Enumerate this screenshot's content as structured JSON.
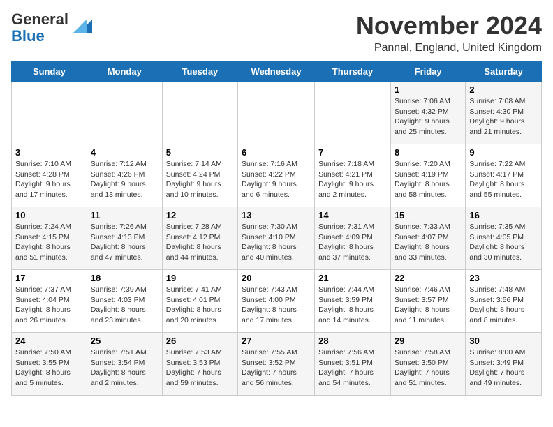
{
  "logo": {
    "line1": "General",
    "line2": "Blue"
  },
  "title": "November 2024",
  "subtitle": "Pannal, England, United Kingdom",
  "days_of_week": [
    "Sunday",
    "Monday",
    "Tuesday",
    "Wednesday",
    "Thursday",
    "Friday",
    "Saturday"
  ],
  "weeks": [
    [
      {
        "day": "",
        "info": ""
      },
      {
        "day": "",
        "info": ""
      },
      {
        "day": "",
        "info": ""
      },
      {
        "day": "",
        "info": ""
      },
      {
        "day": "",
        "info": ""
      },
      {
        "day": "1",
        "info": "Sunrise: 7:06 AM\nSunset: 4:32 PM\nDaylight: 9 hours and 25 minutes."
      },
      {
        "day": "2",
        "info": "Sunrise: 7:08 AM\nSunset: 4:30 PM\nDaylight: 9 hours and 21 minutes."
      }
    ],
    [
      {
        "day": "3",
        "info": "Sunrise: 7:10 AM\nSunset: 4:28 PM\nDaylight: 9 hours and 17 minutes."
      },
      {
        "day": "4",
        "info": "Sunrise: 7:12 AM\nSunset: 4:26 PM\nDaylight: 9 hours and 13 minutes."
      },
      {
        "day": "5",
        "info": "Sunrise: 7:14 AM\nSunset: 4:24 PM\nDaylight: 9 hours and 10 minutes."
      },
      {
        "day": "6",
        "info": "Sunrise: 7:16 AM\nSunset: 4:22 PM\nDaylight: 9 hours and 6 minutes."
      },
      {
        "day": "7",
        "info": "Sunrise: 7:18 AM\nSunset: 4:21 PM\nDaylight: 9 hours and 2 minutes."
      },
      {
        "day": "8",
        "info": "Sunrise: 7:20 AM\nSunset: 4:19 PM\nDaylight: 8 hours and 58 minutes."
      },
      {
        "day": "9",
        "info": "Sunrise: 7:22 AM\nSunset: 4:17 PM\nDaylight: 8 hours and 55 minutes."
      }
    ],
    [
      {
        "day": "10",
        "info": "Sunrise: 7:24 AM\nSunset: 4:15 PM\nDaylight: 8 hours and 51 minutes."
      },
      {
        "day": "11",
        "info": "Sunrise: 7:26 AM\nSunset: 4:13 PM\nDaylight: 8 hours and 47 minutes."
      },
      {
        "day": "12",
        "info": "Sunrise: 7:28 AM\nSunset: 4:12 PM\nDaylight: 8 hours and 44 minutes."
      },
      {
        "day": "13",
        "info": "Sunrise: 7:30 AM\nSunset: 4:10 PM\nDaylight: 8 hours and 40 minutes."
      },
      {
        "day": "14",
        "info": "Sunrise: 7:31 AM\nSunset: 4:09 PM\nDaylight: 8 hours and 37 minutes."
      },
      {
        "day": "15",
        "info": "Sunrise: 7:33 AM\nSunset: 4:07 PM\nDaylight: 8 hours and 33 minutes."
      },
      {
        "day": "16",
        "info": "Sunrise: 7:35 AM\nSunset: 4:05 PM\nDaylight: 8 hours and 30 minutes."
      }
    ],
    [
      {
        "day": "17",
        "info": "Sunrise: 7:37 AM\nSunset: 4:04 PM\nDaylight: 8 hours and 26 minutes."
      },
      {
        "day": "18",
        "info": "Sunrise: 7:39 AM\nSunset: 4:03 PM\nDaylight: 8 hours and 23 minutes."
      },
      {
        "day": "19",
        "info": "Sunrise: 7:41 AM\nSunset: 4:01 PM\nDaylight: 8 hours and 20 minutes."
      },
      {
        "day": "20",
        "info": "Sunrise: 7:43 AM\nSunset: 4:00 PM\nDaylight: 8 hours and 17 minutes."
      },
      {
        "day": "21",
        "info": "Sunrise: 7:44 AM\nSunset: 3:59 PM\nDaylight: 8 hours and 14 minutes."
      },
      {
        "day": "22",
        "info": "Sunrise: 7:46 AM\nSunset: 3:57 PM\nDaylight: 8 hours and 11 minutes."
      },
      {
        "day": "23",
        "info": "Sunrise: 7:48 AM\nSunset: 3:56 PM\nDaylight: 8 hours and 8 minutes."
      }
    ],
    [
      {
        "day": "24",
        "info": "Sunrise: 7:50 AM\nSunset: 3:55 PM\nDaylight: 8 hours and 5 minutes."
      },
      {
        "day": "25",
        "info": "Sunrise: 7:51 AM\nSunset: 3:54 PM\nDaylight: 8 hours and 2 minutes."
      },
      {
        "day": "26",
        "info": "Sunrise: 7:53 AM\nSunset: 3:53 PM\nDaylight: 7 hours and 59 minutes."
      },
      {
        "day": "27",
        "info": "Sunrise: 7:55 AM\nSunset: 3:52 PM\nDaylight: 7 hours and 56 minutes."
      },
      {
        "day": "28",
        "info": "Sunrise: 7:56 AM\nSunset: 3:51 PM\nDaylight: 7 hours and 54 minutes."
      },
      {
        "day": "29",
        "info": "Sunrise: 7:58 AM\nSunset: 3:50 PM\nDaylight: 7 hours and 51 minutes."
      },
      {
        "day": "30",
        "info": "Sunrise: 8:00 AM\nSunset: 3:49 PM\nDaylight: 7 hours and 49 minutes."
      }
    ]
  ]
}
